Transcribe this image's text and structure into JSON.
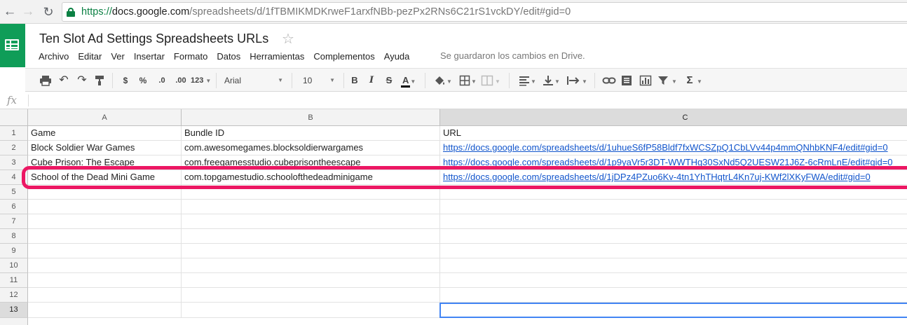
{
  "browser": {
    "url_https": "https://",
    "url_host": "docs.google.com",
    "url_path": "/spreadsheets/d/1fTBMIKMDKrweF1arxfNBb-pezPx2RNs6C21rS1vckDY/edit#gid=0"
  },
  "header": {
    "title": "Ten Slot Ad Settings Spreadsheets URLs",
    "star": "☆",
    "save_status": "Se guardaron los cambios en Drive."
  },
  "menu": [
    "Archivo",
    "Editar",
    "Ver",
    "Insertar",
    "Formato",
    "Datos",
    "Herramientas",
    "Complementos",
    "Ayuda"
  ],
  "toolbar": {
    "currency": "$",
    "percent": "%",
    "dec_decrease": ".0",
    "dec_increase": ".00",
    "more_formats": "123",
    "font": "Arial",
    "font_size": "10",
    "bold": "B",
    "italic": "I",
    "strike": "S",
    "text_color": "A",
    "functions": "Σ"
  },
  "formula_bar": {
    "fx": "fx"
  },
  "columns": [
    "A",
    "B",
    "C"
  ],
  "rows": [
    "1",
    "2",
    "3",
    "4",
    "5",
    "6",
    "7",
    "8",
    "9",
    "10",
    "11",
    "12",
    "13"
  ],
  "cells": {
    "r1": {
      "a": "Game",
      "b": "Bundle ID",
      "c": "URL"
    },
    "r2": {
      "a": "Block Soldier War Games",
      "b": "com.awesomegames.blocksoldierwargames",
      "c": "https://docs.google.com/spreadsheets/d/1uhueS6fP58Bldf7fxWCSZpQ1CbLVv44p4mmQNhbKNF4/edit#gid=0"
    },
    "r3": {
      "a": "Cube Prison: The Escape",
      "b": "com.freegamesstudio.cubeprisontheescape",
      "c": "https://docs.google.com/spreadsheets/d/1p9yaVr5r3DT-WWTHg30SxNd5Q2UESW21J6Z-6cRmLnE/edit#gid=0"
    },
    "r4": {
      "a": "School of the Dead Mini Game",
      "b": "com.topgamestudio.schoolofthedeadminigame",
      "c": "https://docs.google.com/spreadsheets/d/1jDPz4PZuo6Kv-4tn1YhTHqtrL4Kn7uj-KWf2lXKyFWA/edit#gid=0"
    }
  },
  "selected_cell": "C13",
  "colors": {
    "sheets_green": "#0f9d58",
    "highlight": "#ec1763",
    "link": "#1155cc",
    "selection": "#4285f4"
  }
}
